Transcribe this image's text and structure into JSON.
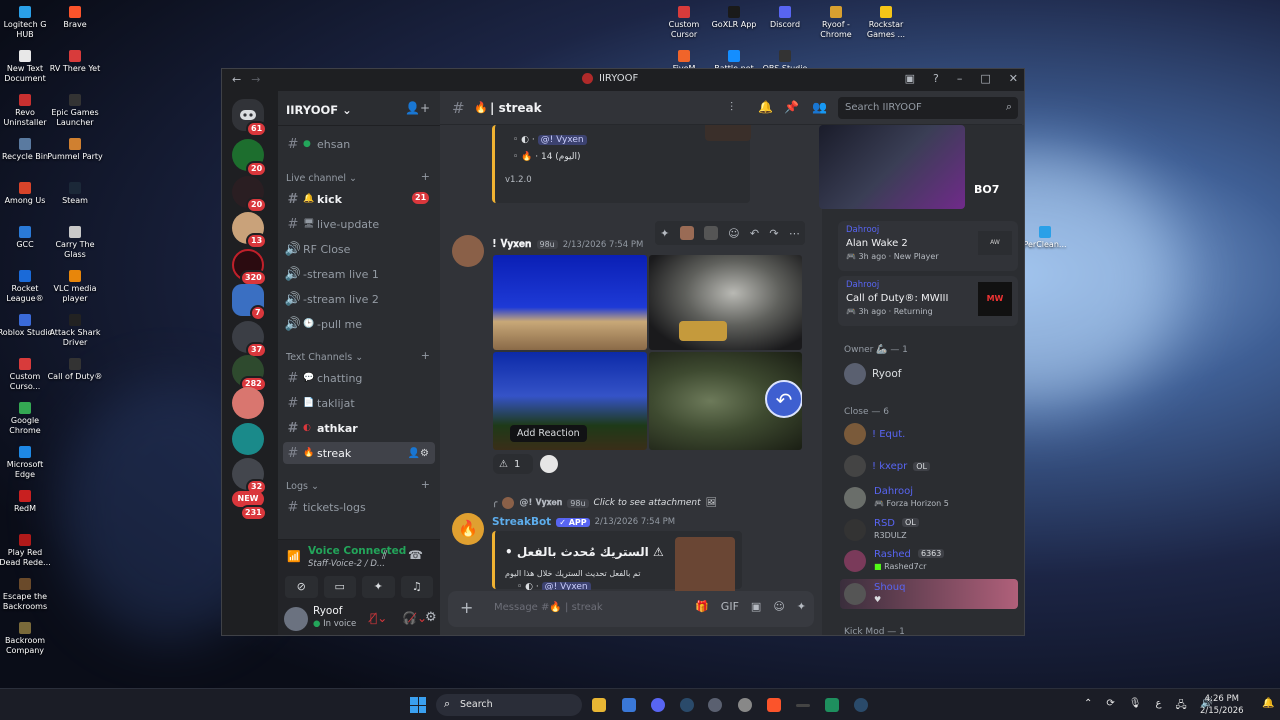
{
  "desktop_icons": [
    {
      "label": "Logitech G HUB",
      "x": "L"
    },
    {
      "label": "Brave"
    },
    {
      "label": "New Text Document"
    },
    {
      "label": "RV There Yet"
    },
    {
      "label": "Revo Uninstaller"
    },
    {
      "label": "Epic Games Launcher"
    },
    {
      "label": "Recycle Bin"
    },
    {
      "label": "Pummel Party"
    },
    {
      "label": "Among Us"
    },
    {
      "label": "Steam"
    },
    {
      "label": "GCC"
    },
    {
      "label": "Carry The Glass"
    },
    {
      "label": "Rocket League®"
    },
    {
      "label": "VLC media player"
    },
    {
      "label": "Roblox Studio"
    },
    {
      "label": "Attack Shark Driver"
    },
    {
      "label": "Custom Curso..."
    },
    {
      "label": "Call of Duty®"
    },
    {
      "label": "Google Chrome"
    },
    {
      "label": "Microsoft Edge"
    },
    {
      "label": "RedM"
    },
    {
      "label": "Play Red Dead Rede..."
    },
    {
      "label": "Escape the Backrooms"
    },
    {
      "label": "Backroom Company"
    },
    {
      "label": "Custom Cursor"
    },
    {
      "label": "GoXLR App"
    },
    {
      "label": "Discord"
    },
    {
      "label": "Ryoof - Chrome"
    },
    {
      "label": "Rockstar Games ..."
    },
    {
      "label": "FiveM"
    },
    {
      "label": "Battle.net"
    },
    {
      "label": "OBS Studio"
    },
    {
      "label": "PerClean..."
    }
  ],
  "window": {
    "title": "IIRYOOF"
  },
  "servers": {
    "badges": [
      "61",
      "20",
      "20",
      "13",
      "320",
      "7",
      "37",
      "282",
      "32",
      "231"
    ],
    "new_label": "NEW"
  },
  "sidebar": {
    "server_name": "IIRYOOF",
    "top_channel": "ehsan",
    "cat_live": "Live channel",
    "kick": "kick",
    "kick_badge": "21",
    "live_update": "live-update",
    "rf_close": "RF Close",
    "stream1": "-stream live 1",
    "stream2": "-stream live 2",
    "pull": "-pull me",
    "cat_text": "Text Channels",
    "chatting": "chatting",
    "taklijat": "taklijat",
    "athkar": "athkar",
    "streak": "streak",
    "cat_logs": "Logs",
    "tickets": "tickets-logs"
  },
  "voice": {
    "status": "Voice Connected",
    "channel": "Staff-Voice-2 / D..."
  },
  "user": {
    "name": "Ryoof",
    "status": "In voice"
  },
  "header": {
    "channel": "streak",
    "search_placeholder": "Search IIRYOOF"
  },
  "chat": {
    "top_embed": {
      "mention": "@! Vyxen",
      "streak_line": "14 (اليوم)",
      "version": "v1.2.0"
    },
    "msg1": {
      "author": "! 𝐕𝐲𝐱𝐞𝐧",
      "tag": "98u",
      "time": "2/13/2026 7:54 PM",
      "reaction_count": "1",
      "tooltip": "Add Reaction"
    },
    "reply": {
      "author": "@! 𝐕𝐲𝐱𝐞𝐧",
      "tag": "98u",
      "text": "Click to see attachment"
    },
    "msg2": {
      "author": "StreakBot",
      "app": "APP",
      "time": "2/13/2026 7:54 PM",
      "embed_title": "الستريك مُحدث بالفعل •",
      "embed_line": "تم بالفعل تحديث الستريك خلال هذا اليوم",
      "mention": "@! Vyxen"
    },
    "input_placeholder": "Message #🔥 | streak"
  },
  "activity": {
    "cards": [
      {
        "user": "Dahrooj",
        "game": "Alan Wake 2",
        "time": "3h ago",
        "tag": "New Player"
      },
      {
        "user": "Dahrooj",
        "game": "Call of Duty®: MWIII",
        "time": "3h ago",
        "tag": "Returning"
      }
    ]
  },
  "members": {
    "owner_heading": "Owner 🦾 — 1",
    "owner": "Ryoof",
    "close_heading": "Close — 6",
    "list": [
      {
        "name": "! Equt.",
        "sub": ""
      },
      {
        "name": "! kxepr",
        "sub": "",
        "tag": "OL"
      },
      {
        "name": "Dahrooj",
        "sub": "Forza Horizon 5"
      },
      {
        "name": "RSD",
        "sub": "R3DULZ",
        "tag": "OL"
      },
      {
        "name": "Rashed",
        "sub": "Rashed7cr",
        "tag": "6363"
      },
      {
        "name": "Shouq",
        "sub": "♥"
      }
    ],
    "kick_heading": "Kick Mod — 1"
  },
  "taskbar": {
    "search": "Search",
    "time": "4:26 PM",
    "date": "2/15/2026",
    "lang": "ع"
  },
  "colors": {
    "bg": "#313338",
    "sidebar": "#2b2d31",
    "rail": "#1e1f22",
    "accent": "#5865f2",
    "red": "#da373c",
    "green": "#23a55a"
  }
}
